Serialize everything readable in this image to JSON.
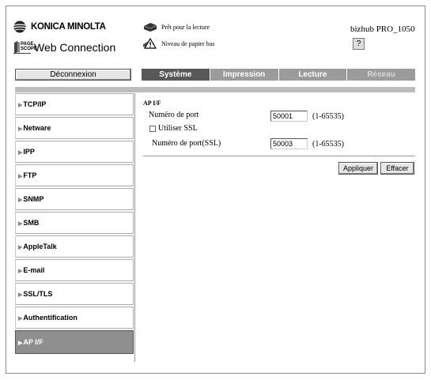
{
  "header": {
    "brand": "KONICA MINOLTA",
    "pagescope": "PAGE SCOPE",
    "webconnection": "Web Connection",
    "status_ready": "Prêt pour la lecture",
    "status_paper": "Niveau de papier bas",
    "model": "bizhub PRO_1050",
    "help": "?"
  },
  "logout_label": "Déconnexion",
  "tabs": [
    {
      "label": "Système"
    },
    {
      "label": "Impression"
    },
    {
      "label": "Lecture"
    },
    {
      "label": "Réseau"
    }
  ],
  "sidebar": {
    "items": [
      {
        "label": "TCP/IP"
      },
      {
        "label": "Netware"
      },
      {
        "label": "IPP"
      },
      {
        "label": "FTP"
      },
      {
        "label": "SNMP"
      },
      {
        "label": "SMB"
      },
      {
        "label": "AppleTalk"
      },
      {
        "label": "E-mail"
      },
      {
        "label": "SSL/TLS"
      },
      {
        "label": "Authentification"
      },
      {
        "label": "AP I/F"
      }
    ],
    "active": "AP I/F"
  },
  "main": {
    "title": "AP I/F",
    "port_label": "Numéro de port",
    "port_value": "50001",
    "port_range": "(1-65535)",
    "ssl_label": "Utiliser SSL",
    "ssl_checked": false,
    "ssl_port_label": "Numéro de port(SSL)",
    "ssl_port_value": "50003",
    "ssl_port_range": "(1-65535)",
    "apply_label": "Appliquer",
    "clear_label": "Effacer"
  },
  "colors": {
    "tab_active": "#585858",
    "tab_inactive": "#9b9b9b",
    "sidebar_active": "#8f8f8f"
  }
}
